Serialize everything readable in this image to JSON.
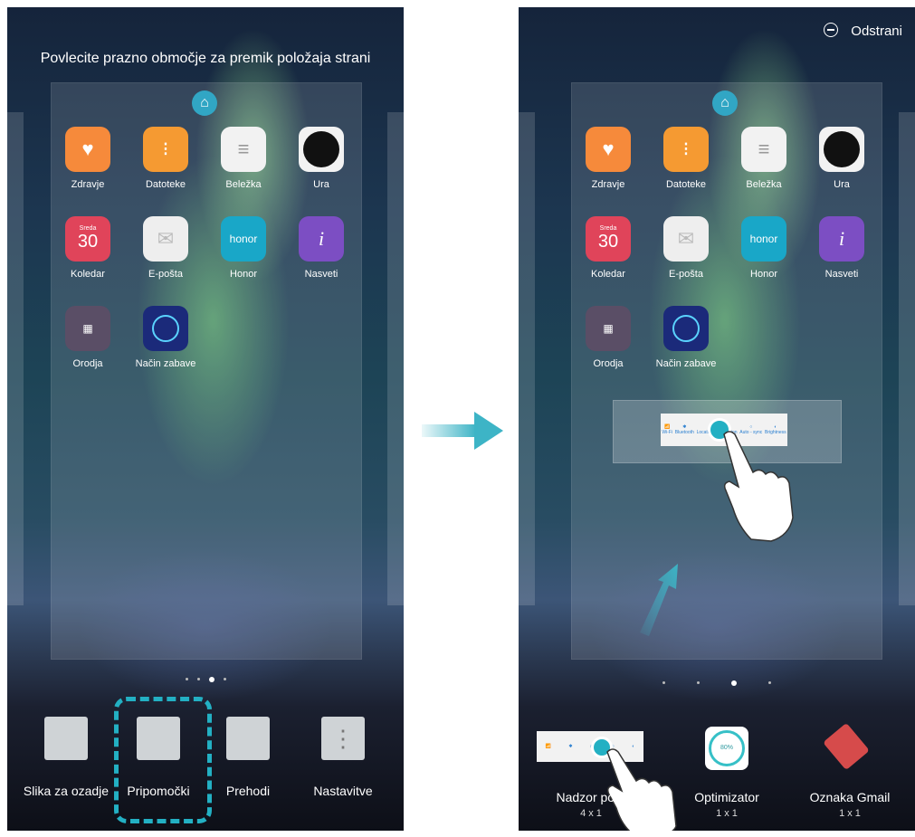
{
  "left_screen": {
    "instruction": "Povlecite prazno območje za premik položaja strani",
    "apps": [
      {
        "label": "Zdravje",
        "icon": "heart-pulse-icon",
        "color": "#f68a3b"
      },
      {
        "label": "Datoteke",
        "icon": "folder-icon",
        "color": "#f59a32"
      },
      {
        "label": "Beležka",
        "icon": "notepad-icon",
        "color": "#f2f2f2"
      },
      {
        "label": "Ura",
        "icon": "clock-icon",
        "color": "#222222"
      },
      {
        "label": "Koledar",
        "icon": "calendar-icon",
        "color": "#e0445a",
        "date_day": "Sreda",
        "date_num": "30"
      },
      {
        "label": "E-pošta",
        "icon": "envelope-icon",
        "color": "#eeeeee"
      },
      {
        "label": "Honor",
        "icon": "honor-icon",
        "color": "#19a7c8",
        "text": "honor"
      },
      {
        "label": "Nasveti",
        "icon": "tips-icon",
        "color": "#7c4ec3",
        "text": "i"
      },
      {
        "label": "Orodja",
        "icon": "tools-folder-icon",
        "color": "#5a4e66"
      },
      {
        "label": "Način zabave",
        "icon": "ring-icon",
        "color": "#1b2a7a"
      }
    ],
    "dock": [
      {
        "label": "Slika za ozadje",
        "icon": "wallpaper-icon"
      },
      {
        "label": "Pripomočki",
        "icon": "widgets-icon"
      },
      {
        "label": "Prehodi",
        "icon": "transitions-icon"
      },
      {
        "label": "Nastavitve",
        "icon": "settings-icon"
      }
    ]
  },
  "right_screen": {
    "remove_label": "Odstrani",
    "apps": [
      {
        "label": "Zdravje"
      },
      {
        "label": "Datoteke"
      },
      {
        "label": "Beležka"
      },
      {
        "label": "Ura"
      },
      {
        "label": "Koledar",
        "date_day": "Sreda",
        "date_num": "30"
      },
      {
        "label": "E-pošta"
      },
      {
        "label": "Honor",
        "text": "honor"
      },
      {
        "label": "Nasveti",
        "text": "i"
      },
      {
        "label": "Orodja"
      },
      {
        "label": "Način zabave"
      }
    ],
    "widget_cells": [
      "Wi-Fi",
      "Bluetooth",
      "Location information",
      "Auto - sync",
      "Brightness"
    ],
    "widget_options": [
      {
        "label": "Nadzor pora",
        "size": "4 x 1"
      },
      {
        "label": "Optimizator",
        "size": "1 x 1",
        "value": "80%"
      },
      {
        "label": "Oznaka Gmail",
        "size": "1 x 1"
      }
    ]
  },
  "colors": {
    "accent": "#23b0c3",
    "arrow": "#3db4c6"
  }
}
